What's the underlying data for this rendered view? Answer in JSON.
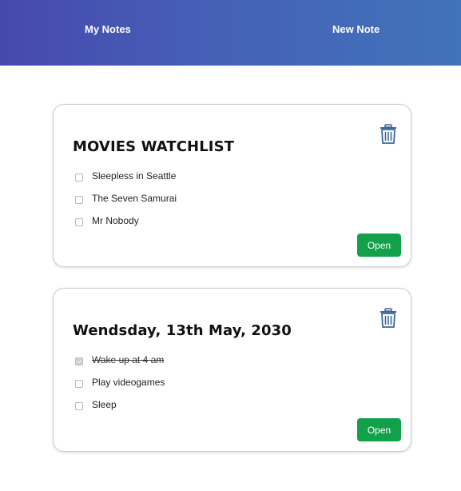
{
  "nav": {
    "my_notes": "My Notes",
    "new_note": "New Note"
  },
  "notes": [
    {
      "title": "MOVIES WATCHLIST",
      "items": [
        {
          "text": "Sleepless in Seattle",
          "checked": false
        },
        {
          "text": "The Seven Samurai",
          "checked": false
        },
        {
          "text": "Mr Nobody",
          "checked": false
        }
      ],
      "open_label": "Open",
      "delete_icon": "trash-icon"
    },
    {
      "title": "Wendsday, 13th May, 2030",
      "items": [
        {
          "text": "Wake up at 4 am",
          "checked": true
        },
        {
          "text": "Play videogames",
          "checked": false
        },
        {
          "text": "Sleep",
          "checked": false
        }
      ],
      "open_label": "Open",
      "delete_icon": "trash-icon"
    }
  ],
  "colors": {
    "header_gradient_start": "#4748ae",
    "header_gradient_end": "#4173b9",
    "open_button": "#12a14a",
    "trash_icon": "#3d6799"
  }
}
